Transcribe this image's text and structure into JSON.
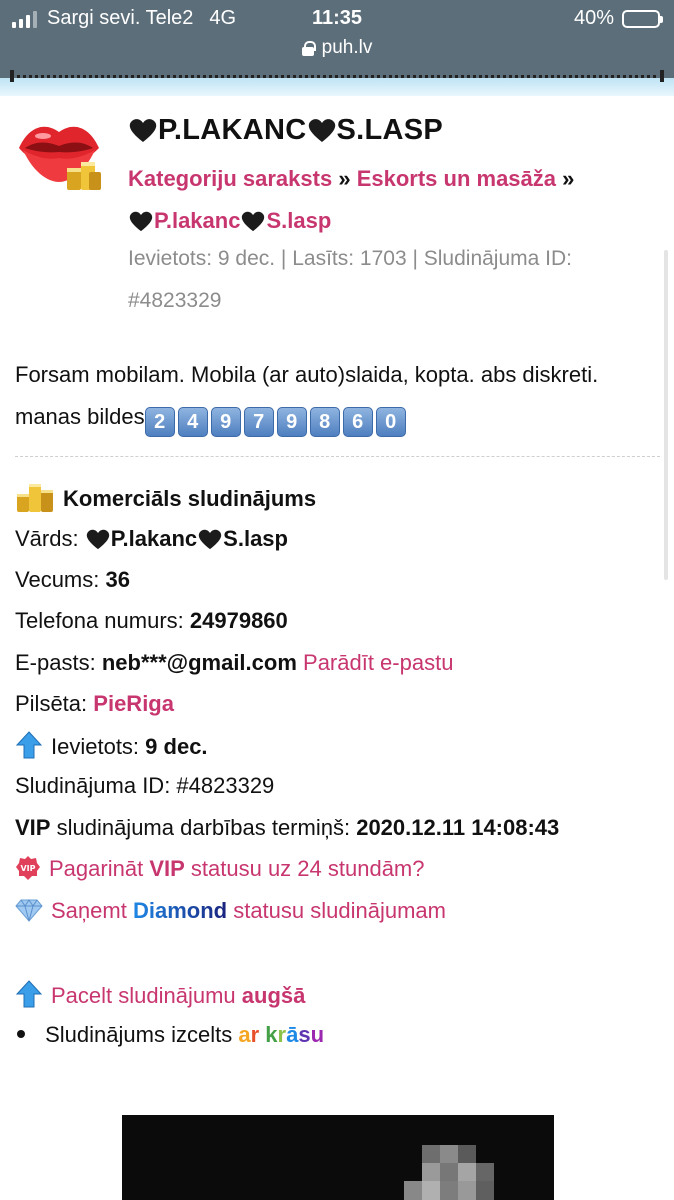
{
  "status_bar": {
    "carrier": "Sargi sevi. Tele2",
    "network": "4G",
    "time": "11:35",
    "battery": "40%",
    "url": "puh.lv"
  },
  "ad": {
    "title": "P.LAKANC",
    "title_part2": "S.LASP",
    "breadcrumb": {
      "category_list": "Kategoriju saraksts",
      "separator": "»",
      "category": "Eskorts un masāža",
      "current_part1": "P.lakanc",
      "current_part2": "S.lasp"
    },
    "meta": "Ievietots: 9 dec. | Lasīts: 1703 | Sludinājuma ID: #4823329",
    "description": "Forsam mobilam. Mobila (ar auto)slaida, kopta. abs diskreti. manas bildes",
    "description_digits": [
      "2",
      "4",
      "9",
      "7",
      "9",
      "8",
      "6",
      "0"
    ]
  },
  "details": {
    "commercial_label": "Komerciāls sludinājums",
    "name_label": "Vārds:",
    "name_part1": "P.lakanc",
    "name_part2": "S.lasp",
    "age_label": "Vecums:",
    "age_value": "36",
    "phone_label": "Telefona numurs:",
    "phone_value": "24979860",
    "email_label": "E-pasts:",
    "email_value": "neb***@gmail.com",
    "email_link": "Parādīt e-pastu",
    "city_label": "Pilsēta:",
    "city_value": "PieRiga",
    "posted_label": "Ievietots:",
    "posted_value": "9 dec.",
    "id_label": "Sludinājuma ID: #4823329",
    "vip_label": "VIP",
    "vip_text": "sludinājuma darbības termiņš:",
    "vip_value": "2020.12.11 14:08:43"
  },
  "actions": {
    "extend_vip_prefix": "Pagarināt",
    "extend_vip_bold": "VIP",
    "extend_vip_suffix": "statusu uz 24 stundām?",
    "diamond_prefix": "Saņemt",
    "diamond_word": "Diamond",
    "diamond_suffix": "statusu sludinājumam",
    "raise_prefix": "Pacelt sludinājumu",
    "raise_bold": "augšā",
    "highlight_text": "Sludinājums izcelts",
    "highlight_colored": [
      "a",
      "r",
      " ",
      "k",
      "r",
      "ā",
      "s",
      "u"
    ]
  },
  "colors": {
    "link": "#c8366f",
    "statusbar": "#5c6e7a",
    "meta_text": "#8c8c8c",
    "diamond_blue": "#1e88e5",
    "diamond_dark": "#1a237e"
  },
  "icons": [
    "lips-coins-icon",
    "black-heart-icon",
    "number-keycap-icon",
    "coins-icon",
    "up-arrow-icon",
    "vip-badge-icon",
    "diamond-icon"
  ]
}
